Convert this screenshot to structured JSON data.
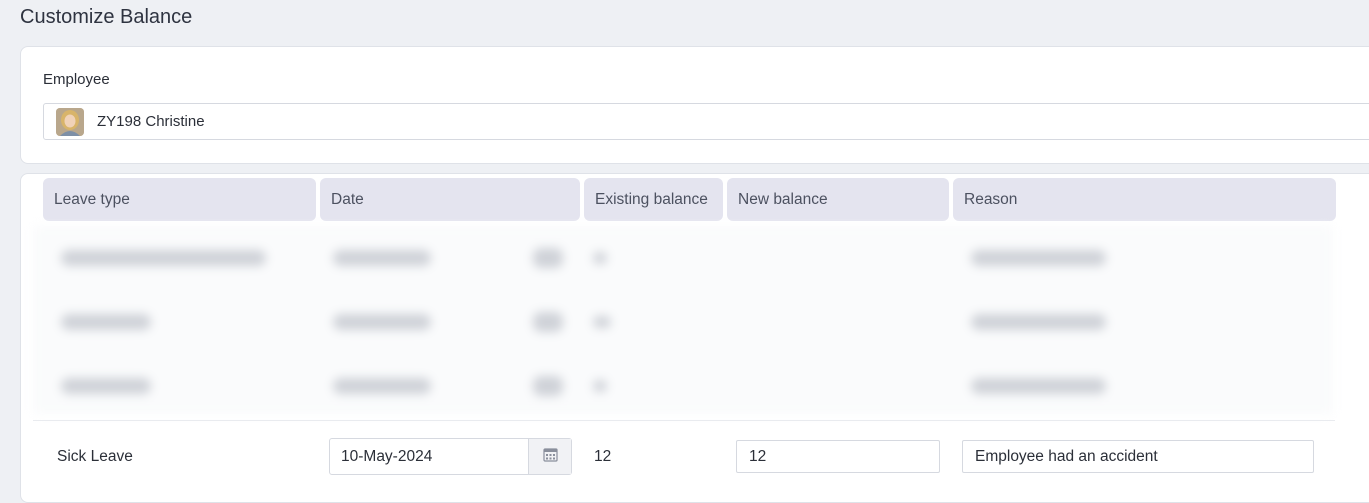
{
  "page": {
    "title": "Customize Balance"
  },
  "employee": {
    "label": "Employee",
    "selected": "ZY198 Christine"
  },
  "table": {
    "headers": [
      "Leave type",
      "Date",
      "Existing balance",
      "New balance",
      "Reason"
    ],
    "editable_row": {
      "leave_type": "Sick Leave",
      "date": "10-May-2024",
      "existing_balance": "12",
      "new_balance": "12",
      "reason": "Employee had an accident"
    }
  },
  "icons": {
    "calendar": "calendar-icon",
    "avatar": "avatar"
  }
}
